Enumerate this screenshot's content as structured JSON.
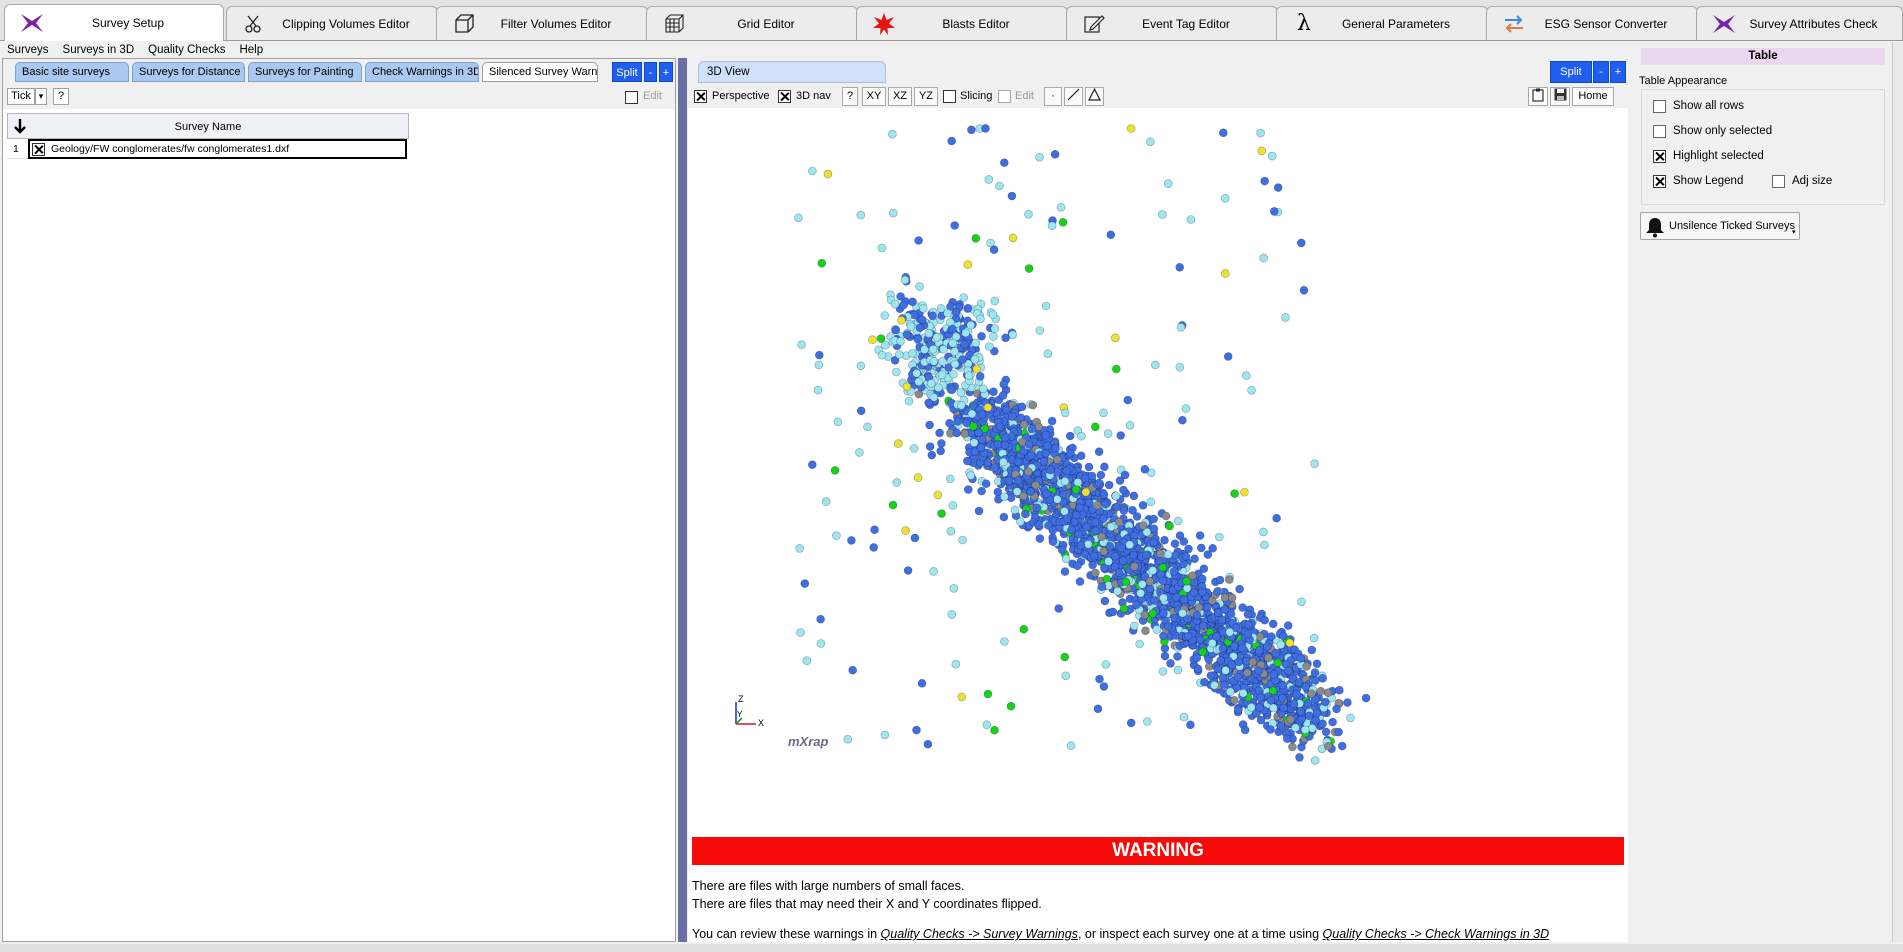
{
  "app_tabs": [
    {
      "label": "Survey Setup",
      "icon": "mxrap-logo-icon",
      "active": true
    },
    {
      "label": "Clipping Volumes Editor",
      "icon": "scissors-icon",
      "active": false
    },
    {
      "label": "Filter Volumes Editor",
      "icon": "cube-icon",
      "active": false
    },
    {
      "label": "Grid Editor",
      "icon": "grid-cube-icon",
      "active": false
    },
    {
      "label": "Blasts Editor",
      "icon": "blast-star-icon",
      "active": false
    },
    {
      "label": "Event Tag Editor",
      "icon": "pencil-icon",
      "active": false
    },
    {
      "label": "General Parameters",
      "icon": "lambda-icon",
      "active": false
    },
    {
      "label": "ESG Sensor Converter",
      "icon": "swap-arrows-icon",
      "active": false
    },
    {
      "label": "Survey Attributes Check",
      "icon": "mxrap-logo-icon",
      "active": false
    }
  ],
  "menu": [
    "Surveys",
    "Surveys in 3D",
    "Quality Checks",
    "Help"
  ],
  "survey_tabs": [
    "Basic site surveys",
    "Surveys for Distance T",
    "Surveys for Painting",
    "Check Warnings in 3D",
    "Silenced Survey Warn"
  ],
  "survey_tab_buttons": {
    "split": "Split",
    "minus": "-",
    "plus": "+"
  },
  "left_toolbar": {
    "tick": "Tick",
    "dropdown": "▾",
    "help": "?",
    "edit": "Edit"
  },
  "table": {
    "header": "Survey Name",
    "rows": [
      {
        "index": "1",
        "checked": true,
        "name": "Geology/FW conglomerates/fw conglomerates1.dxf"
      }
    ]
  },
  "view": {
    "tab_label": "3D View",
    "split": "Split",
    "minus": "-",
    "plus": "+",
    "toolbar": {
      "perspective": "Perspective",
      "perspective_checked": true,
      "nav3d": "3D nav",
      "nav3d_checked": true,
      "help": "?",
      "xy": "XY",
      "xz": "XZ",
      "yz": "YZ",
      "slicing": "Slicing",
      "edit": "Edit",
      "home": "Home"
    },
    "axis_labels": {
      "z": "Z",
      "y": "Y",
      "x": "X"
    },
    "watermark": "mXrap",
    "colors": {
      "blue": "#3f6ee0",
      "cyan": "#9de6ef",
      "grey": "#8a8a8a",
      "green": "#17d317",
      "yellow": "#f0e030"
    }
  },
  "warning": {
    "title": "WARNING",
    "line1": "There are files with large numbers of small faces.",
    "line2": "There are files that may need their X and Y coordinates flipped.",
    "line3_prefix": "You can review these warnings in ",
    "line3_link1": "Quality Checks -> Survey Warnings",
    "line3_mid": ", or inspect each survey one at a time using ",
    "line3_link2": "Quality Checks -> Check Warnings in 3D"
  },
  "right_panel": {
    "title": "Table",
    "group_label": "Table Appearance",
    "options": [
      {
        "label": "Show all rows",
        "checked": false
      },
      {
        "label": "Show only selected",
        "checked": false
      },
      {
        "label": "Highlight selected",
        "checked": true
      },
      {
        "label": "Show Legend",
        "checked": true
      },
      {
        "label": "Adj size",
        "checked": false
      }
    ],
    "unsilence_button": "Unsilence Ticked Surveys"
  }
}
